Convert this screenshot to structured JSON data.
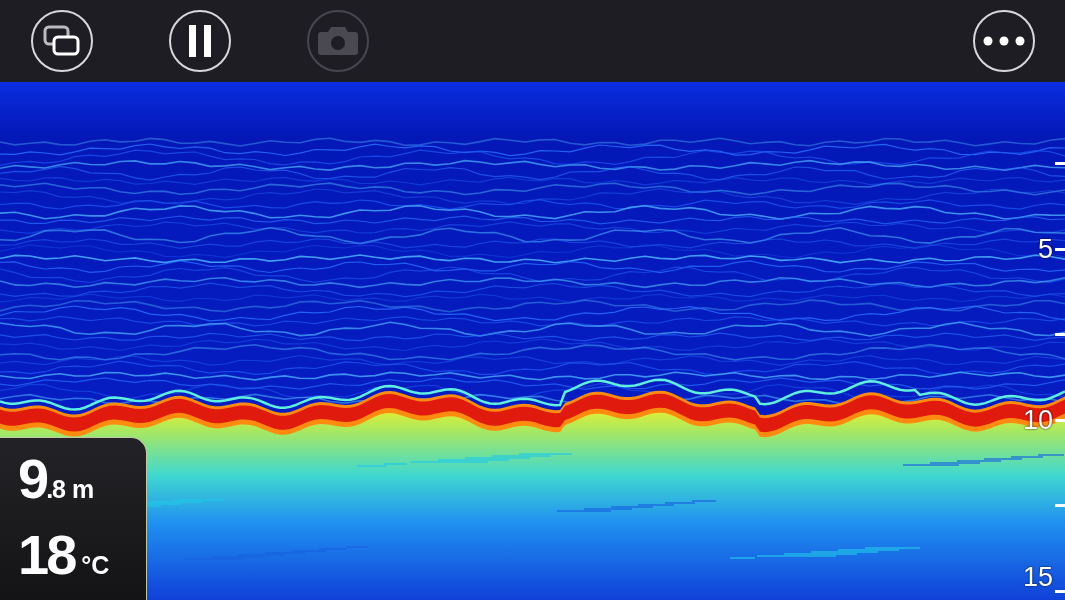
{
  "toolbar": {
    "buttons": [
      {
        "kind": "windows",
        "disabled": false
      },
      {
        "kind": "pause",
        "disabled": false
      },
      {
        "kind": "camera",
        "disabled": true
      },
      {
        "kind": "more",
        "disabled": false
      }
    ]
  },
  "depth_scale": {
    "labels": [
      "5",
      "10",
      "15"
    ]
  },
  "readout": {
    "depth_whole": "9",
    "depth_fraction": ".8",
    "depth_unit": "m",
    "temperature": "18",
    "temperature_unit": "°C"
  }
}
